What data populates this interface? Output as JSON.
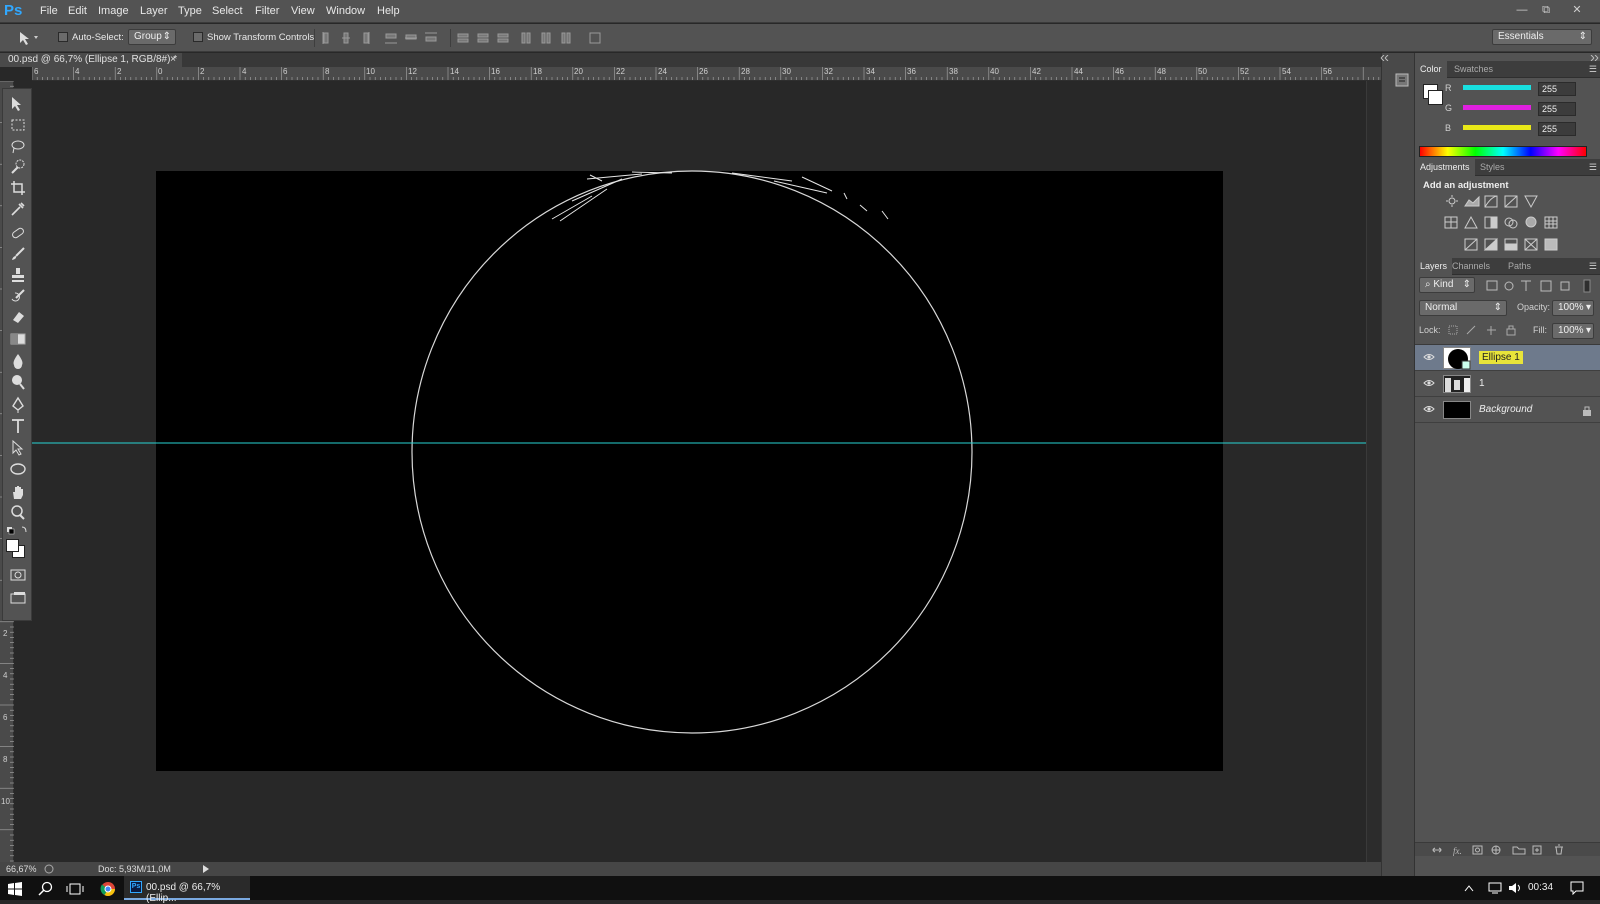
{
  "app": {
    "logo": "Ps"
  },
  "menu": [
    "File",
    "Edit",
    "Image",
    "Layer",
    "Type",
    "Select",
    "Filter",
    "View",
    "Window",
    "Help"
  ],
  "options": {
    "auto_select_label": "Auto-Select:",
    "auto_select_value": "Group",
    "show_transform_label": "Show Transform Controls",
    "workspace": "Essentials"
  },
  "document": {
    "tab_title": "00.psd @ 66,7% (Ellipse 1, RGB/8#) *",
    "close": "×"
  },
  "ruler": {
    "h_labels": [
      "6",
      "4",
      "2",
      "0",
      "2",
      "4",
      "6",
      "8",
      "10",
      "12",
      "14",
      "16",
      "18",
      "20",
      "22",
      "24",
      "26",
      "28",
      "30",
      "32",
      "34",
      "36",
      "38",
      "40",
      "42",
      "44",
      "46",
      "48",
      "50",
      "52",
      "54",
      "56"
    ],
    "v_labels": [
      "2",
      "4",
      "6",
      "8",
      "10"
    ]
  },
  "canvas": {
    "guide_color": "#27d4d4",
    "stroke_color": "#d8d8d8"
  },
  "status": {
    "zoom": "66,67%",
    "doc": "Doc: 5,93M/11,0M"
  },
  "color_panel": {
    "tabs": [
      "Color",
      "Swatches"
    ],
    "channels": [
      {
        "label": "R",
        "value": "255",
        "color": "#19e0e0"
      },
      {
        "label": "G",
        "value": "255",
        "color": "#e020e0"
      },
      {
        "label": "B",
        "value": "255",
        "color": "#e8e818"
      }
    ]
  },
  "adjust_panel": {
    "tabs": [
      "Adjustments",
      "Styles"
    ],
    "heading": "Add an adjustment"
  },
  "layers_panel": {
    "tabs": [
      "Layers",
      "Channels",
      "Paths"
    ],
    "filter": "Kind",
    "blend_mode": "Normal",
    "opacity_label": "Opacity:",
    "opacity": "100%",
    "lock_label": "Lock:",
    "fill_label": "Fill:",
    "fill": "100%",
    "layers": [
      {
        "name": "Ellipse 1",
        "selected": true
      },
      {
        "name": "1",
        "selected": false
      },
      {
        "name": "Background",
        "selected": false,
        "locked": true
      }
    ]
  },
  "taskbar": {
    "app_label": "00.psd @ 66,7% (Ellip...",
    "time": "00:34"
  }
}
